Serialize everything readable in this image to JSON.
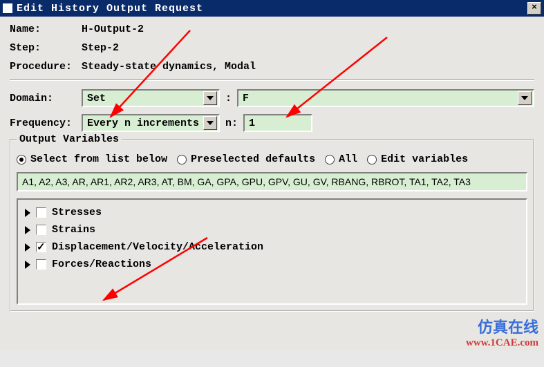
{
  "title": "Edit History Output Request",
  "fields": {
    "name_label": "Name:",
    "name_value": "H-Output-2",
    "step_label": "Step:",
    "step_value": "Step-2",
    "procedure_label": "Procedure:",
    "procedure_value": "Steady-state dynamics, Modal",
    "domain_label": "Domain:",
    "domain_value": "Set",
    "domain_set_value": "F",
    "frequency_label": "Frequency:",
    "frequency_value": "Every n increments",
    "n_label": "n:",
    "n_value": "1",
    "colon": ":"
  },
  "output_variables": {
    "legend": "Output Variables",
    "radios": {
      "select_list": "Select from list below",
      "preselected": "Preselected defaults",
      "all": "All",
      "edit": "Edit variables"
    },
    "varlist": "A1, A2, A3, AR, AR1, AR2, AR3, AT, BM, GA, GPA, GPU, GPV, GU, GV, RBANG, RBROT, TA1, TA2, TA3",
    "tree": [
      {
        "label": "Stresses",
        "checked": false
      },
      {
        "label": "Strains",
        "checked": false
      },
      {
        "label": "Displacement/Velocity/Acceleration",
        "checked": true
      },
      {
        "label": "Forces/Reactions",
        "checked": false
      }
    ]
  },
  "watermark": {
    "line1": "仿真在线",
    "line2": "www.1CAE.com"
  }
}
